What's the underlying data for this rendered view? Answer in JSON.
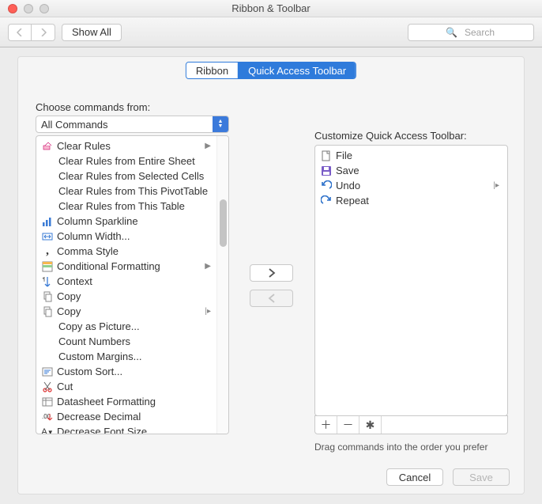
{
  "window": {
    "title": "Ribbon & Toolbar"
  },
  "toolbar": {
    "show_all": "Show All",
    "search_placeholder": "Search"
  },
  "tabs": {
    "ribbon": "Ribbon",
    "qat": "Quick Access Toolbar"
  },
  "choose_label": "Choose commands from:",
  "dropdown": {
    "value": "All Commands"
  },
  "left_commands": [
    {
      "icon": "eraser",
      "label": "Clear Rules",
      "submenu": true
    },
    {
      "icon": "",
      "label": "Clear Rules from Entire Sheet"
    },
    {
      "icon": "",
      "label": "Clear Rules from Selected Cells"
    },
    {
      "icon": "",
      "label": "Clear Rules from This PivotTable"
    },
    {
      "icon": "",
      "label": "Clear Rules from This Table"
    },
    {
      "icon": "sparkline",
      "label": "Column Sparkline"
    },
    {
      "icon": "width",
      "label": "Column Width..."
    },
    {
      "icon": "comma",
      "label": "Comma Style"
    },
    {
      "icon": "condfmt",
      "label": "Conditional Formatting",
      "submenu": true
    },
    {
      "icon": "context",
      "label": "Context"
    },
    {
      "icon": "copy",
      "label": "Copy"
    },
    {
      "icon": "copy",
      "label": "Copy",
      "split": true
    },
    {
      "icon": "",
      "label": "Copy as Picture..."
    },
    {
      "icon": "",
      "label": "Count Numbers"
    },
    {
      "icon": "",
      "label": "Custom Margins..."
    },
    {
      "icon": "sort",
      "label": "Custom Sort..."
    },
    {
      "icon": "cut",
      "label": "Cut"
    },
    {
      "icon": "datasheet",
      "label": "Datasheet Formatting"
    },
    {
      "icon": "decdec",
      "label": "Decrease Decimal"
    },
    {
      "icon": "decfont",
      "label": "Decrease Font Size"
    }
  ],
  "right_label": "Customize Quick Access Toolbar:",
  "right_commands": [
    {
      "icon": "file",
      "label": "File"
    },
    {
      "icon": "save",
      "label": "Save"
    },
    {
      "icon": "undo",
      "label": "Undo",
      "split": true
    },
    {
      "icon": "repeat",
      "label": "Repeat"
    }
  ],
  "hint": "Drag commands into the order you prefer",
  "footer": {
    "cancel": "Cancel",
    "save": "Save"
  }
}
